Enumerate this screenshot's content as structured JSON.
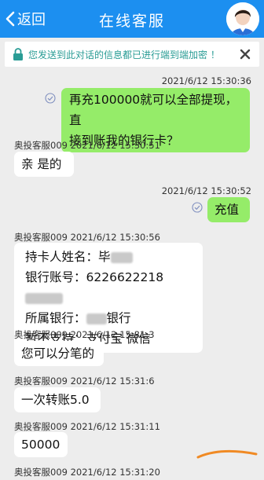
{
  "header": {
    "back_label": "返回",
    "title": "在线客服"
  },
  "notice": {
    "text": "您发送到此对话的信息都已进行端到端加密 ！"
  },
  "messages": [
    {
      "time": "2021/6/12 15:30:36",
      "text_line1": "再充100000就可以全部提现，直",
      "text_line2": "接到账我的银行卡？"
    },
    {
      "sender": "奥投客服009",
      "time": "2021/6/12 15:30:51",
      "text": "亲 是的"
    },
    {
      "time": "2021/6/12 15:30:52",
      "text": "充值"
    },
    {
      "sender": "奥投客服009",
      "time": "2021/6/12 15:30:56",
      "line1": "持卡人姓名：毕",
      "line2": "银行账号：6226622218",
      "line3_suffix": "银行",
      "line3_prefix": "所属银行：",
      "line4": "暂不支持：支付宝 微信"
    },
    {
      "sender": "奥投客服009",
      "time": "2021/6/12 15:31:3",
      "text": "您可以分笔的"
    },
    {
      "sender": "奥投客服009",
      "time": "2021/6/12 15:31:6",
      "text": "一次转账5.0"
    },
    {
      "sender": "奥投客服009",
      "time": "2021/6/12 15:31:11",
      "text": "50000"
    },
    {
      "sender": "奥投客服009",
      "time": "2021/6/12 15:31:20"
    }
  ],
  "colors": {
    "header_bg": "#1c8ff0",
    "sent_bubble": "#95ec69",
    "received_bubble": "#ffffff",
    "annotation": "#f08a24"
  }
}
